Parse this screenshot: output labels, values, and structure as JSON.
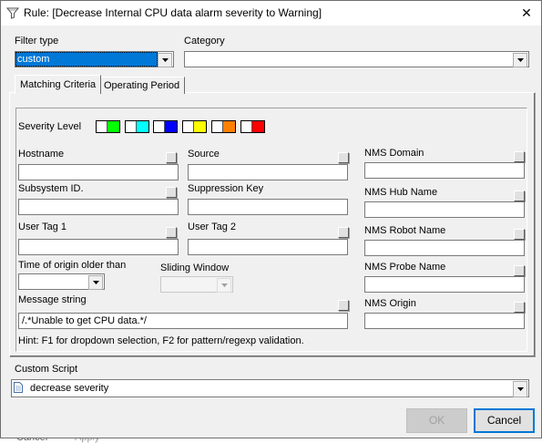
{
  "window": {
    "title": "Rule: [Decrease Internal CPU data alarm severity to Warning]",
    "close_glyph": "✕"
  },
  "filter_type": {
    "label": "Filter type",
    "value": "custom"
  },
  "category": {
    "label": "Category",
    "value": ""
  },
  "tabs": [
    {
      "label": "Matching Criteria",
      "active": true
    },
    {
      "label": "Operating Period",
      "active": false
    }
  ],
  "severity": {
    "label": "Severity Level",
    "colors": [
      "#00ff00",
      "#00ffff",
      "#0000ff",
      "#ffff00",
      "#ff8000",
      "#ff0000"
    ]
  },
  "fields": {
    "hostname": {
      "label": "Hostname",
      "value": ""
    },
    "source": {
      "label": "Source",
      "value": ""
    },
    "subsystem_id": {
      "label": "Subsystem ID.",
      "value": ""
    },
    "suppression_key": {
      "label": "Suppression Key",
      "value": ""
    },
    "user_tag_1": {
      "label": "User Tag 1",
      "value": ""
    },
    "user_tag_2": {
      "label": "User Tag 2",
      "value": ""
    },
    "time_of_origin": {
      "label": "Time of origin older than",
      "value": ""
    },
    "sliding_window": {
      "label": "Sliding Window",
      "value": ""
    },
    "message_string": {
      "label": "Message string",
      "value": "/.*Unable to get CPU data.*/"
    },
    "nms_domain": {
      "label": "NMS Domain",
      "value": ""
    },
    "nms_hub_name": {
      "label": "NMS Hub Name",
      "value": ""
    },
    "nms_robot_name": {
      "label": "NMS Robot Name",
      "value": ""
    },
    "nms_probe_name": {
      "label": "NMS Probe Name",
      "value": ""
    },
    "nms_origin": {
      "label": "NMS Origin",
      "value": ""
    }
  },
  "hint": "Hint: F1 for dropdown selection, F2 for pattern/regexp validation.",
  "custom_script": {
    "label": "Custom Script",
    "value": "decrease severity",
    "icon": "document-icon"
  },
  "buttons": {
    "ok": "OK",
    "cancel": "Cancel"
  },
  "background_window": {
    "cancel": "Cancel",
    "apply": "Apply"
  }
}
